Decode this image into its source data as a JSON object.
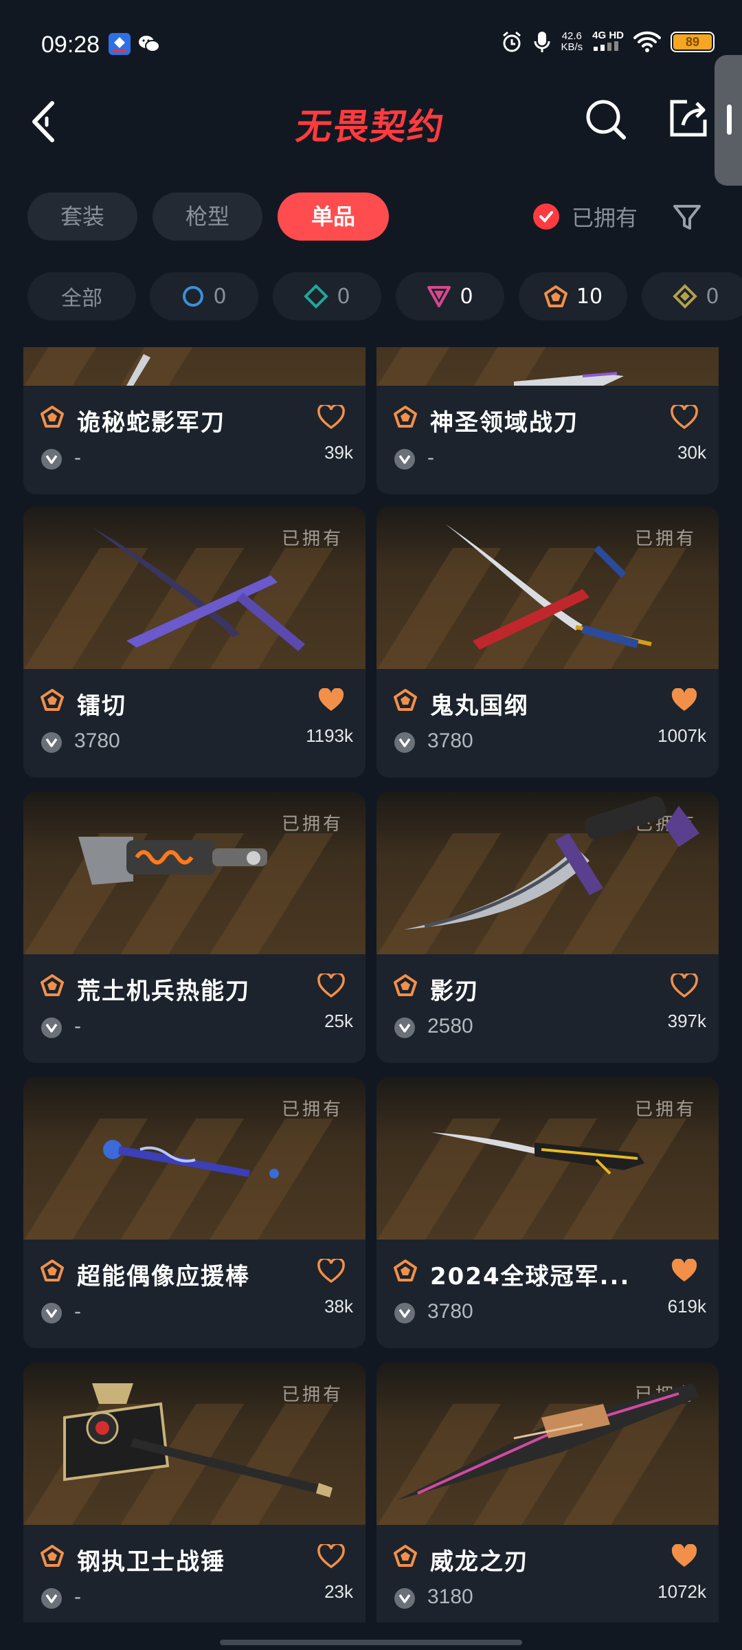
{
  "status_bar": {
    "time": "09:28",
    "net_speed_value": "42.6",
    "net_speed_unit": "KB/s",
    "network": "4G HD",
    "battery": "89"
  },
  "header": {
    "title": "无畏契约"
  },
  "tabs": [
    {
      "label": "套装",
      "active": false
    },
    {
      "label": "枪型",
      "active": false
    },
    {
      "label": "单品",
      "active": true
    }
  ],
  "owned_filter_label": "已拥有",
  "rarity_filters": [
    {
      "label": "全部"
    },
    {
      "count": "0",
      "color": "#3b8fd9",
      "shape": "circle"
    },
    {
      "count": "0",
      "color": "#1fa89a",
      "shape": "diamond"
    },
    {
      "count": "0",
      "color": "#d9478f",
      "shape": "triangle"
    },
    {
      "count": "10",
      "color": "#f2904a",
      "shape": "pentagon"
    },
    {
      "count": "0",
      "color": "#b3a04a",
      "shape": "diamond"
    }
  ],
  "owned_tag": "已拥有",
  "items": [
    {
      "name": "诡秘蛇影军刀",
      "price": "-",
      "likes": "39k",
      "favorited": false,
      "owned": false
    },
    {
      "name": "神圣领域战刀",
      "price": "-",
      "likes": "30k",
      "favorited": false,
      "owned": false
    },
    {
      "name": "镭切",
      "price": "3780",
      "likes": "1193k",
      "favorited": true,
      "owned": true
    },
    {
      "name": "鬼丸国纲",
      "price": "3780",
      "likes": "1007k",
      "favorited": true,
      "owned": true
    },
    {
      "name": "荒土机兵热能刀",
      "price": "-",
      "likes": "25k",
      "favorited": false,
      "owned": true
    },
    {
      "name": "影刃",
      "price": "2580",
      "likes": "397k",
      "favorited": false,
      "owned": true
    },
    {
      "name": "超能偶像应援棒",
      "price": "-",
      "likes": "38k",
      "favorited": false,
      "owned": true
    },
    {
      "name": "2024全球冠军...",
      "price": "3780",
      "likes": "619k",
      "favorited": true,
      "owned": true
    },
    {
      "name": "钢执卫士战锤",
      "price": "-",
      "likes": "23k",
      "favorited": false,
      "owned": true
    },
    {
      "name": "威龙之刃",
      "price": "3180",
      "likes": "1072k",
      "favorited": true,
      "owned": true
    }
  ],
  "colors": {
    "accent": "#ff3b3f",
    "background": "#121821",
    "card": "#1c232c",
    "heart": "#f2904a"
  }
}
